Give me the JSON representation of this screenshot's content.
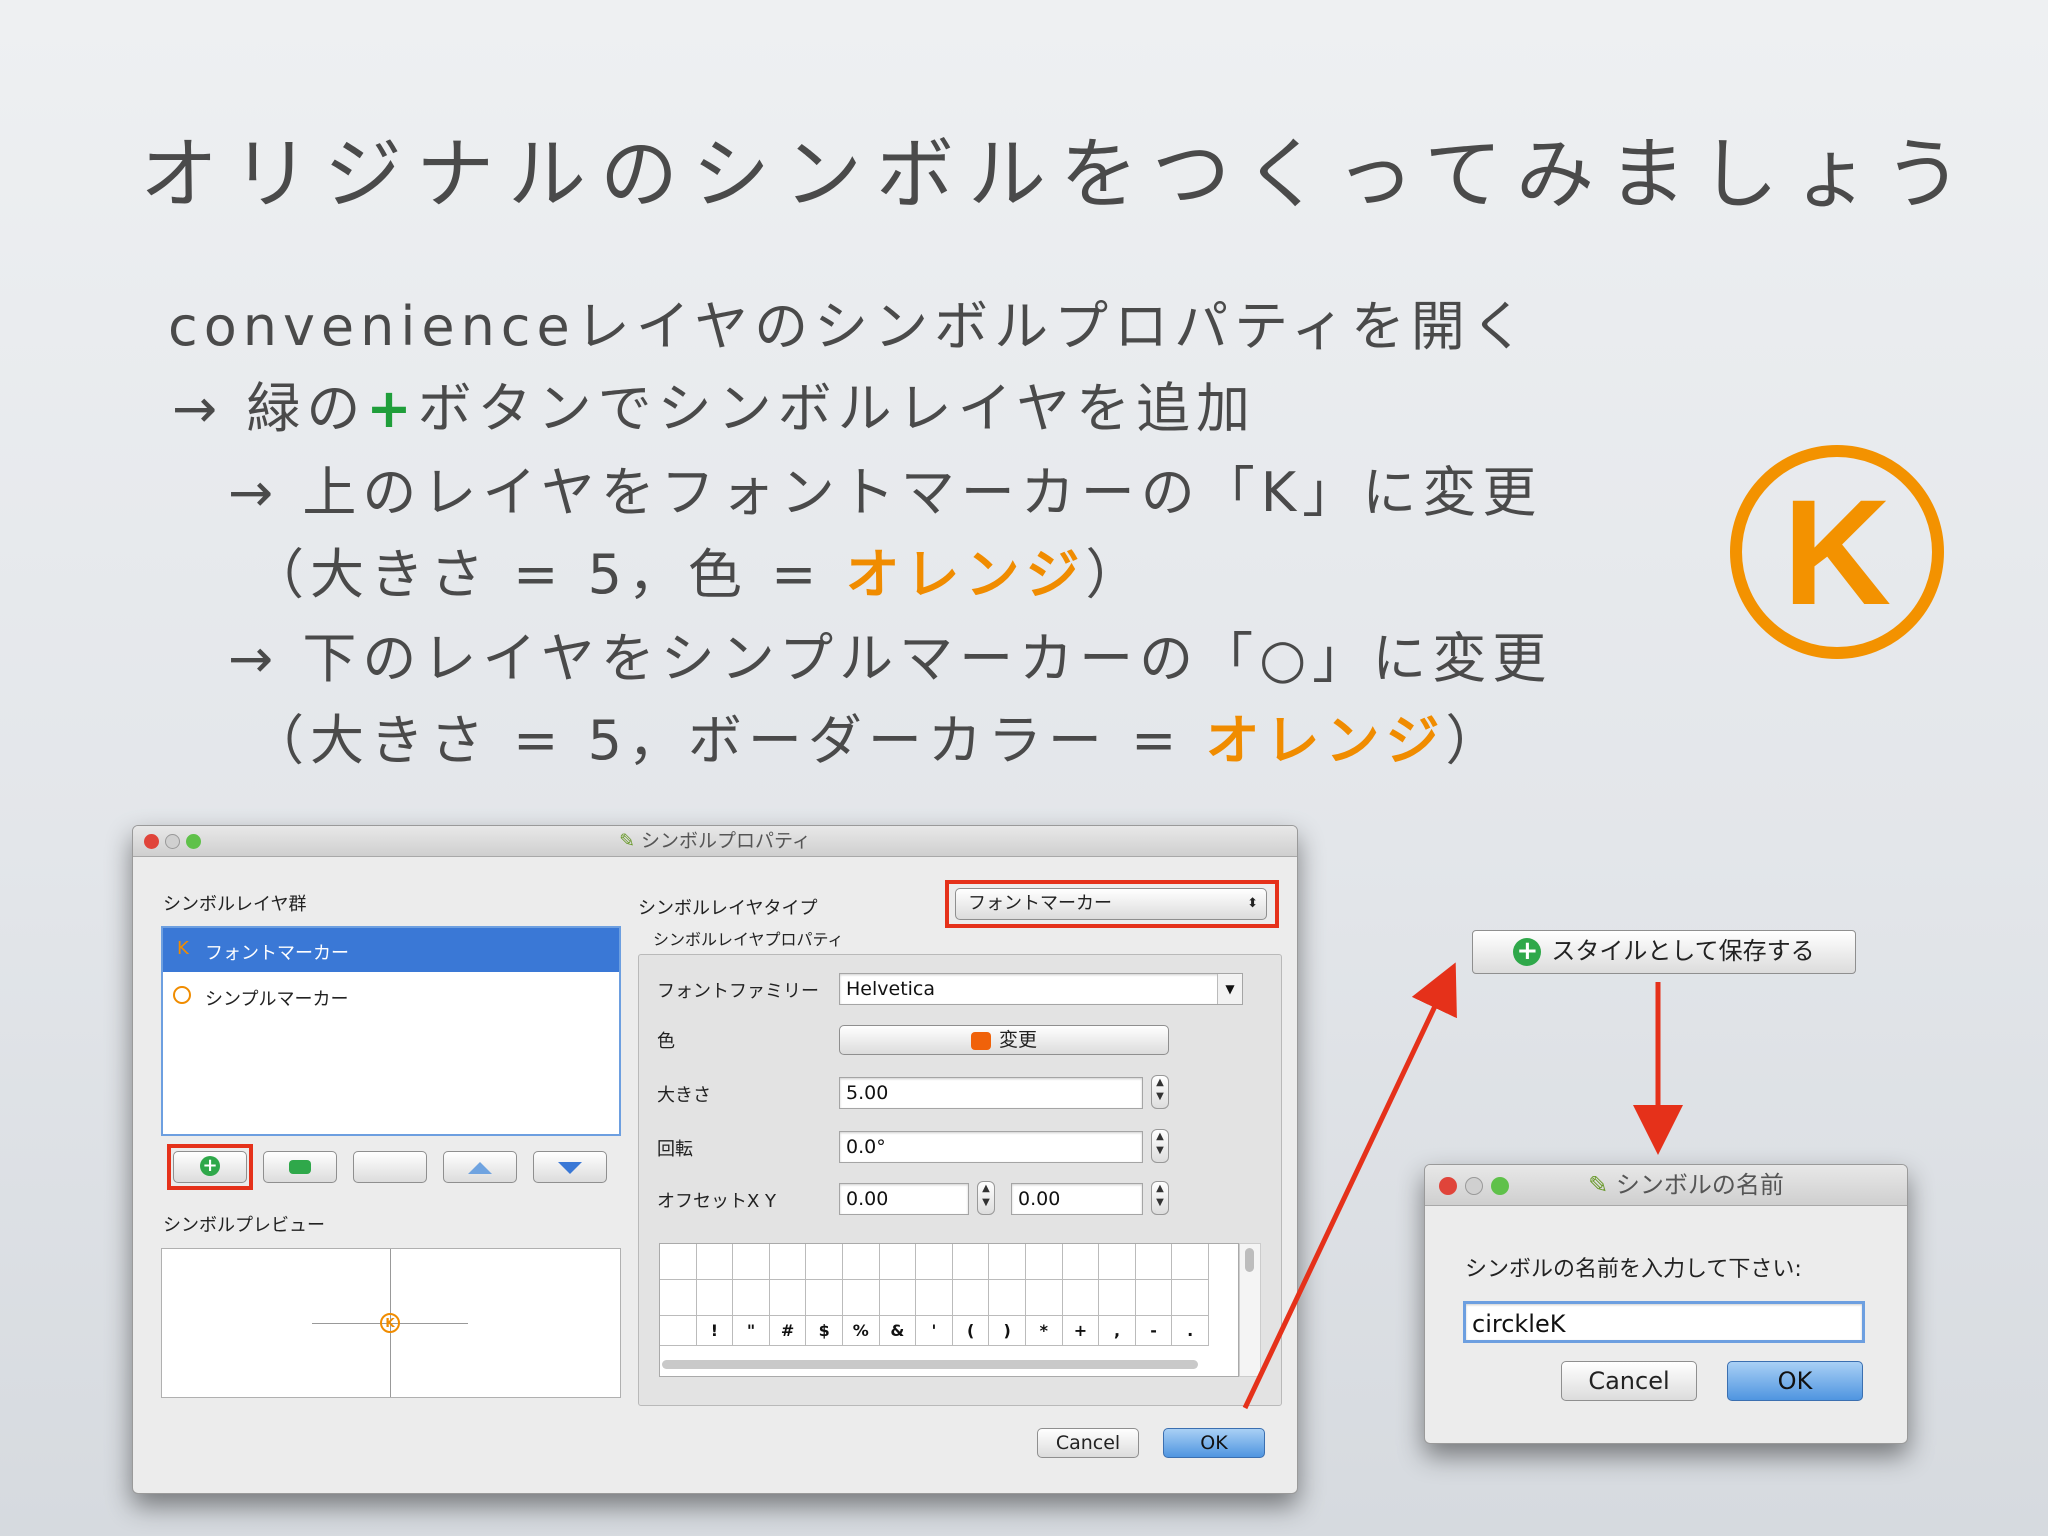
{
  "slide": {
    "title": "オリジナルのシンボルをつくってみましょう",
    "line1": "convenienceレイヤのシンボルプロパティを開く",
    "line2_prefix": "→ 緑の",
    "line2_plus": "+",
    "line2_suffix": "ボタンでシンボルレイヤを追加",
    "line3": "→ 上のレイヤをフォントマーカーの「K」に変更",
    "line4_prefix": "（大きさ = 5，色 = ",
    "line4_orange": "オレンジ",
    "line4_suffix": "）",
    "line5": "→ 下のレイヤをシンプルマーカーの「○」に変更",
    "line6_prefix": "（大きさ = 5，ボーダーカラー = ",
    "line6_orange": "オレンジ",
    "line6_suffix": "）",
    "badge_letter": "K"
  },
  "symbol_window": {
    "title": "シンボルプロパティ",
    "layers_label": "シンボルレイヤ群",
    "layers": [
      {
        "icon": "K",
        "label": "フォントマーカー",
        "selected": true
      },
      {
        "icon": "circle",
        "label": "シンプルマーカー",
        "selected": false
      }
    ],
    "preview_label": "シンボルプレビュー",
    "preview_glyph": "K",
    "layer_type_label": "シンボルレイヤタイプ",
    "layer_type_value": "フォントマーカー",
    "layer_props_label": "シンボルレイヤプロパティ",
    "font_family_label": "フォントファミリー",
    "font_family_value": "Helvetica",
    "color_label": "色",
    "color_button": "変更",
    "color_swatch": "#f0620a",
    "size_label": "大きさ",
    "size_value": "5.00",
    "rotation_label": "回転",
    "rotation_value": "0.0°",
    "offset_label": "オフセットX Y",
    "offset_x": "0.00",
    "offset_y": "0.00",
    "glyphs": [
      "",
      "!",
      "\"",
      "#",
      "$",
      "%",
      "&",
      "'",
      "(",
      ")",
      "*",
      "+",
      ",",
      "-",
      "."
    ],
    "cancel": "Cancel",
    "ok": "OK"
  },
  "save_style_button": "スタイルとして保存する",
  "name_dialog": {
    "title": "シンボルの名前",
    "prompt": "シンボルの名前を入力して下さい:",
    "value": "circkleK",
    "cancel": "Cancel",
    "ok": "OK"
  },
  "colors": {
    "accent_orange": "#f39200",
    "plus_green": "#1f9e3a",
    "highlight_red": "#e5311a",
    "selection_blue": "#3a78d6"
  }
}
